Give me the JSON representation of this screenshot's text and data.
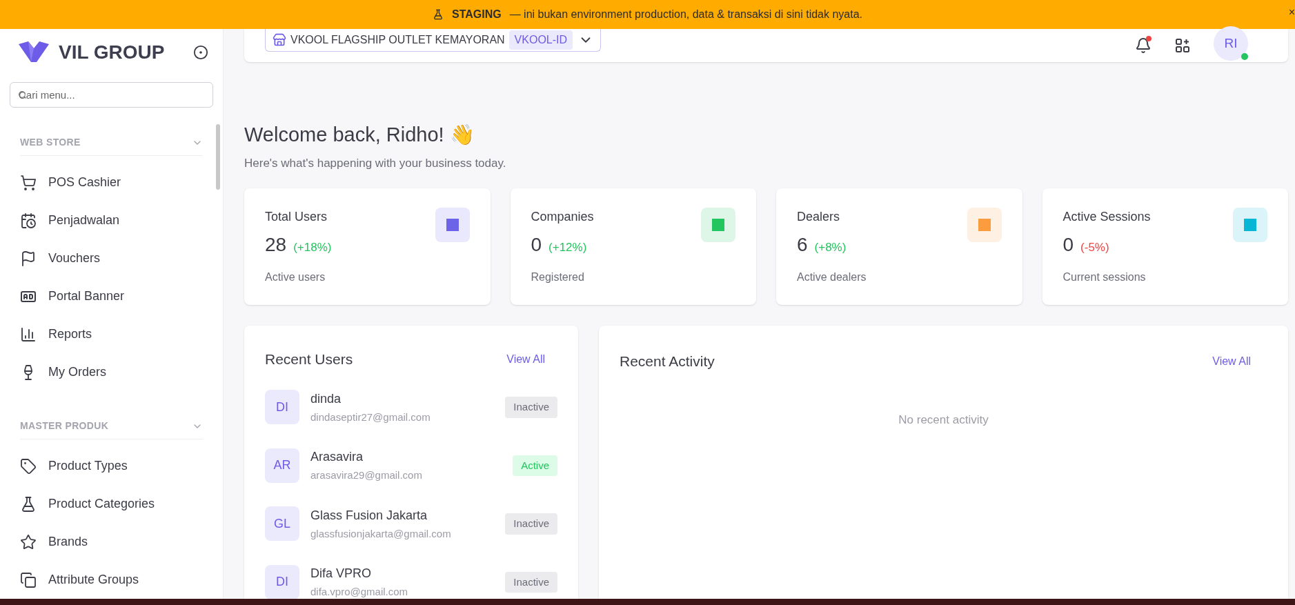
{
  "banner": {
    "label": "STAGING",
    "message": "— ini bukan environment production, data & transaksi di sini tidak nyata.",
    "close": "×"
  },
  "sidebar": {
    "brand": "VIL GROUP",
    "search": {
      "placeholder": "Cari menu..."
    },
    "sections": [
      {
        "title": "WEB STORE",
        "expanded": true,
        "items": [
          {
            "label": "POS Cashier"
          },
          {
            "label": "Penjadwalan"
          },
          {
            "label": "Vouchers"
          },
          {
            "label": "Portal Banner"
          },
          {
            "label": "Reports"
          },
          {
            "label": "My Orders"
          }
        ]
      },
      {
        "title": "MASTER PRODUK",
        "expanded": true,
        "items": [
          {
            "label": "Product Types"
          },
          {
            "label": "Product Categories"
          },
          {
            "label": "Brands"
          },
          {
            "label": "Attribute Groups"
          }
        ]
      }
    ]
  },
  "topbar": {
    "outlet": "VKOOL FLAGSHIP OUTLET KEMAYORAN",
    "outlet_code": "VKOOL-ID",
    "notification_dot": true,
    "avatar": "RI",
    "online": true
  },
  "welcome": {
    "title": "Welcome back, Ridho! 👋",
    "subtitle": "Here's what's happening with your business today."
  },
  "stats": [
    {
      "title": "Total Users",
      "value": "28",
      "change": "(+18%)",
      "negative": false,
      "caption": "Active users",
      "color": "#6c63e8"
    },
    {
      "title": "Companies",
      "value": "0",
      "change": "(+12%)",
      "negative": false,
      "caption": "Registered",
      "color": "#22c55e"
    },
    {
      "title": "Dealers",
      "value": "6",
      "change": "(+8%)",
      "negative": false,
      "caption": "Active dealers",
      "color": "#fb9d3e"
    },
    {
      "title": "Active Sessions",
      "value": "0",
      "change": "(-5%)",
      "negative": true,
      "caption": "Current sessions",
      "color": "#06b6d4"
    }
  ],
  "recent_users": {
    "title": "Recent Users",
    "link": "View All",
    "users": [
      {
        "initials": "DI",
        "name": "dinda",
        "email": "dindaseptir27@gmail.com",
        "status": "Inactive",
        "active": false
      },
      {
        "initials": "AR",
        "name": "Arasavira",
        "email": "arasavira29@gmail.com",
        "status": "Active",
        "active": true
      },
      {
        "initials": "GL",
        "name": "Glass Fusion Jakarta",
        "email": "glassfusionjakarta@gmail.com",
        "status": "Inactive",
        "active": false
      },
      {
        "initials": "DI",
        "name": "Difa VPRO",
        "email": "difa.vpro@gmail.com",
        "status": "Inactive",
        "active": false
      }
    ]
  },
  "recent_activity": {
    "title": "Recent Activity",
    "link": "View All",
    "empty": "No recent activity"
  }
}
